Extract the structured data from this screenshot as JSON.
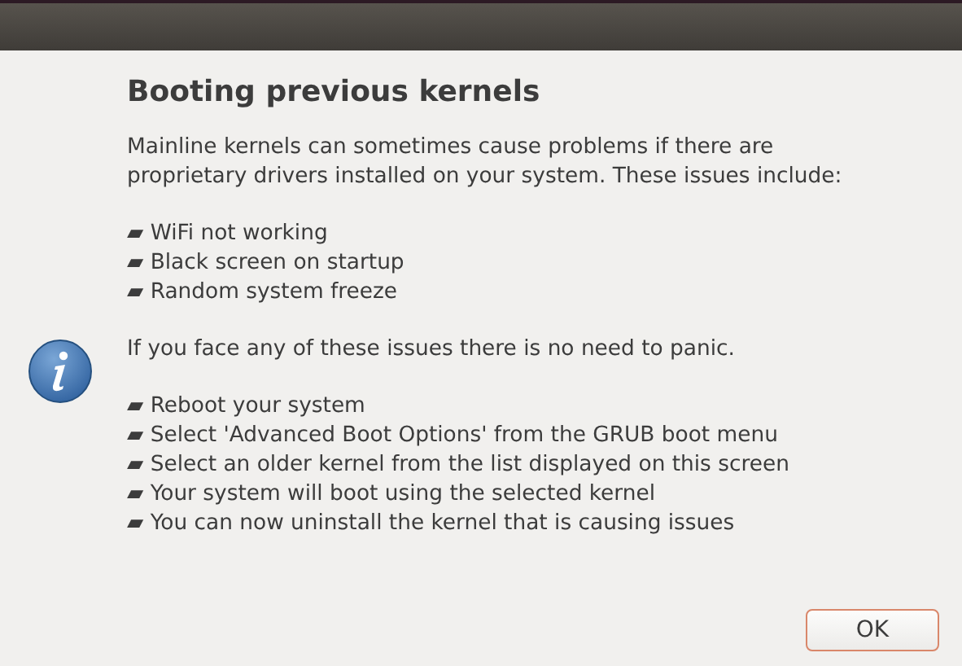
{
  "dialog": {
    "heading": "Booting previous kernels",
    "blocks": [
      {
        "kind": "paragraph",
        "lines": [
          "Mainline kernels can sometimes cause problems if there are proprietary drivers installed on your system. These issues include:"
        ]
      },
      {
        "kind": "list",
        "lines": [
          "▰ WiFi not working",
          "▰ Black screen on startup",
          "▰ Random system freeze"
        ]
      },
      {
        "kind": "paragraph",
        "lines": [
          "If you face any of these issues there is no need to panic."
        ]
      },
      {
        "kind": "list",
        "lines": [
          "▰ Reboot your system",
          "▰ Select 'Advanced Boot Options' from the GRUB boot menu",
          "▰ Select an older kernel from the list displayed on this screen",
          "▰ Your system will boot using the selected kernel",
          "▰ You can now uninstall the kernel that is causing issues"
        ]
      }
    ],
    "buttons": [
      "OK"
    ]
  }
}
